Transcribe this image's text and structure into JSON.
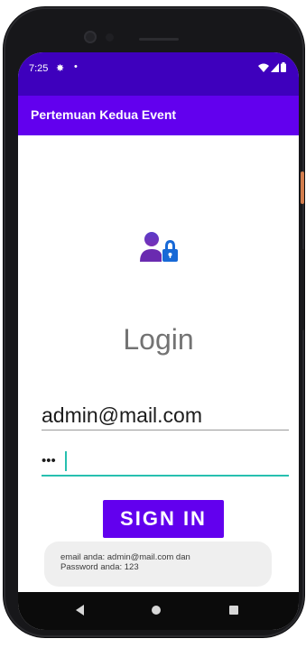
{
  "status_bar": {
    "time": "7:25",
    "gear_glyph": "✸",
    "dot_glyph": "•"
  },
  "app_bar": {
    "title": "Pertemuan Kedua Event"
  },
  "login": {
    "title": "Login",
    "email_value": "admin@mail.com",
    "password_mask": "•••",
    "signin_label": "SIGN IN"
  },
  "toast": {
    "line1": "email anda: admin@mail.com dan",
    "line2": "Password anda: 123"
  },
  "colors": {
    "status_bar": "#3e00bd",
    "app_bar": "#6200ee",
    "accent": "#6200ee",
    "focus_underline": "#27c0b0"
  }
}
